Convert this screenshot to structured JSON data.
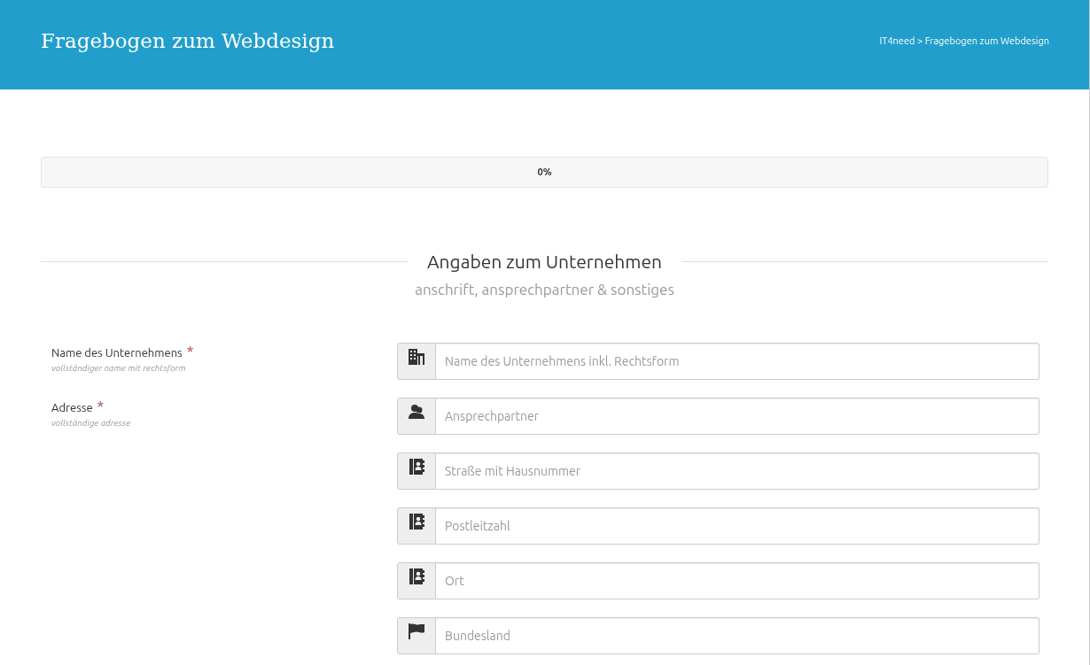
{
  "header": {
    "title": "Fragebogen zum Webdesign",
    "breadcrumb": "IT4need > Fragebogen zum Webdesign"
  },
  "progress": {
    "level": 0,
    "label": "0%"
  },
  "section": {
    "title": "Angaben zum Unternehmen",
    "subtitle": "anschrift, ansprechpartner & sonstiges"
  },
  "questions": [
    {
      "label": "Name des Unternehmens",
      "required_mark": "*",
      "hint": "vollständiger name mit rechtsform",
      "fields": [
        {
          "kind": "building",
          "placeholder": "Name des Unternehmens inkl. Rechtsform"
        }
      ]
    },
    {
      "label": "Adresse",
      "required_mark": "*",
      "hint": "vollständige adresse",
      "fields": [
        {
          "kind": "people",
          "placeholder": "Ansprechpartner"
        },
        {
          "kind": "addressbook",
          "placeholder": "Straße mit Hausnummer"
        },
        {
          "kind": "addressbook",
          "placeholder": "Postleitzahl"
        },
        {
          "kind": "addressbook",
          "placeholder": "Ort"
        },
        {
          "kind": "flag",
          "placeholder": "Bundesland"
        }
      ]
    }
  ]
}
